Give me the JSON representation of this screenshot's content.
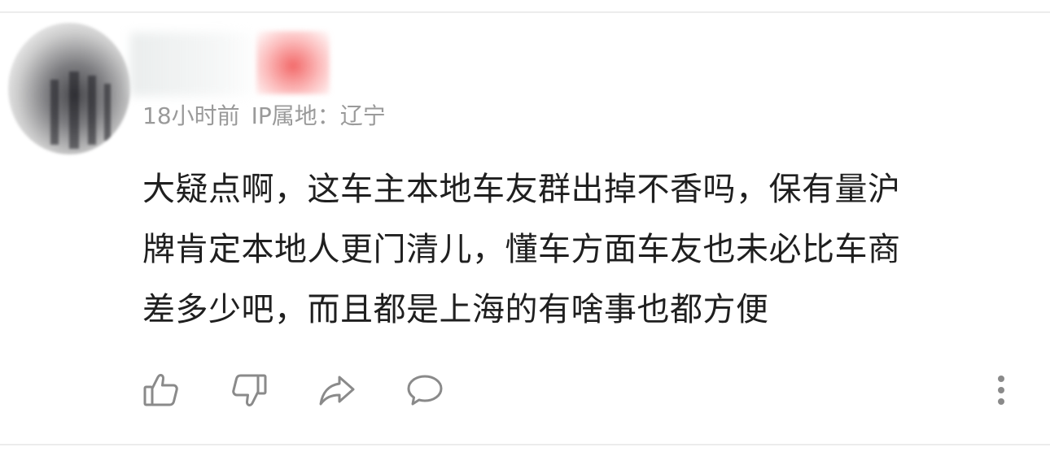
{
  "comment": {
    "time": "18小时前",
    "ip_location": "IP属地：辽宁",
    "lines": [
      "大疑点啊，这车主本地车友群出掉不香吗，保有量沪",
      "牌肯定本地人更门清儿，懂车方面车友也未必比车商",
      "差多少吧，而且都是上海的有啥事也都方便"
    ]
  },
  "actions": {
    "like_icon": "thumbs-up-icon",
    "dislike_icon": "thumbs-down-icon",
    "share_icon": "share-icon",
    "comment_icon": "comment-bubble-icon",
    "more_icon": "more-vertical-icon"
  },
  "colors": {
    "text_primary": "#1f1f1f",
    "text_secondary": "#9a9a9a",
    "icon": "#8a8a8a"
  }
}
